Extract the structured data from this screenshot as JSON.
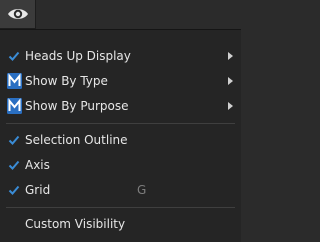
{
  "toolbar": {
    "icon": "eye-icon"
  },
  "menu": {
    "items": [
      {
        "label": "Heads Up Display",
        "icon": "check-icon",
        "submenu": true
      },
      {
        "label": "Show By Type",
        "icon": "m-badge-icon",
        "submenu": true
      },
      {
        "label": "Show By Purpose",
        "icon": "m-badge-icon",
        "submenu": true
      },
      {
        "label": "Selection Outline",
        "icon": "check-icon"
      },
      {
        "label": "Axis",
        "icon": "check-icon"
      },
      {
        "label": "Grid",
        "icon": "check-icon",
        "shortcut": "G"
      },
      {
        "label": "Custom Visibility"
      }
    ]
  },
  "colors": {
    "accent": "#3a8cd6",
    "menu_bg": "#252525",
    "text": "#e6e6e6",
    "shortcut": "#7d7d7d"
  }
}
